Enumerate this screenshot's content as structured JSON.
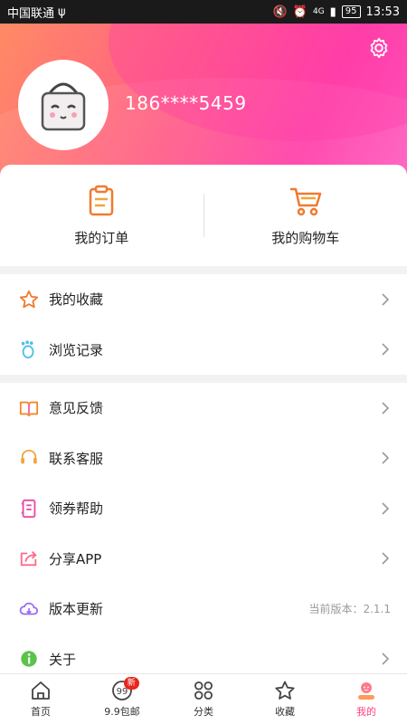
{
  "status_bar": {
    "carrier": "中国联通",
    "battery": "95",
    "time": "13:53",
    "network": "4G"
  },
  "header": {
    "phone": "186****5459"
  },
  "orders": {
    "my_orders": "我的订单",
    "my_cart": "我的购物车"
  },
  "menu_group1": [
    {
      "label": "我的收藏",
      "icon": "star-icon"
    },
    {
      "label": "浏览记录",
      "icon": "footprint-icon"
    }
  ],
  "menu_group2": [
    {
      "label": "意见反馈",
      "icon": "book-icon"
    },
    {
      "label": "联系客服",
      "icon": "headset-icon"
    },
    {
      "label": "领券帮助",
      "icon": "notebook-icon"
    },
    {
      "label": "分享APP",
      "icon": "share-icon"
    },
    {
      "label": "版本更新",
      "icon": "cloud-icon",
      "extra": "当前版本：2.1.1"
    },
    {
      "label": "关于",
      "icon": "info-icon"
    }
  ],
  "tabbar": {
    "home": "首页",
    "free_shipping": "9.9包邮",
    "badge": "新",
    "category": "分类",
    "favorites": "收藏",
    "mine": "我的"
  },
  "colors": {
    "accent": "#ff3d7f",
    "header_start": "#ff8a64",
    "header_end": "#ff3ea8"
  }
}
